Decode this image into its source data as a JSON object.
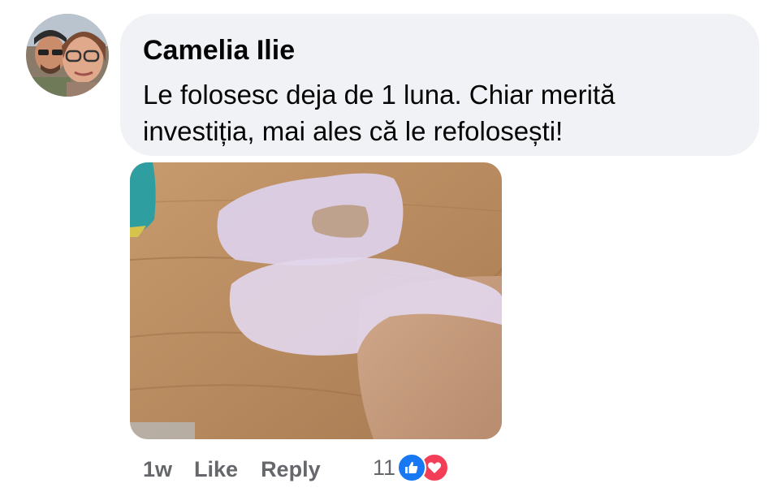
{
  "comment": {
    "author": "Camelia Ilie",
    "text_line1": "Le folosesc deja de 1 luna. Chiar merită",
    "text_line2": "investiția, mai ales că le refolosești!",
    "avatar_icon": "profile-photo-couple",
    "photo_icon": "attached-photo-silicone-socks"
  },
  "actions": {
    "time": "1w",
    "like_label": "Like",
    "reply_label": "Reply"
  },
  "reactions": {
    "count": "11",
    "types": [
      "like",
      "love"
    ],
    "colors": {
      "like": "#1877f2",
      "love": "#f33e58"
    }
  }
}
